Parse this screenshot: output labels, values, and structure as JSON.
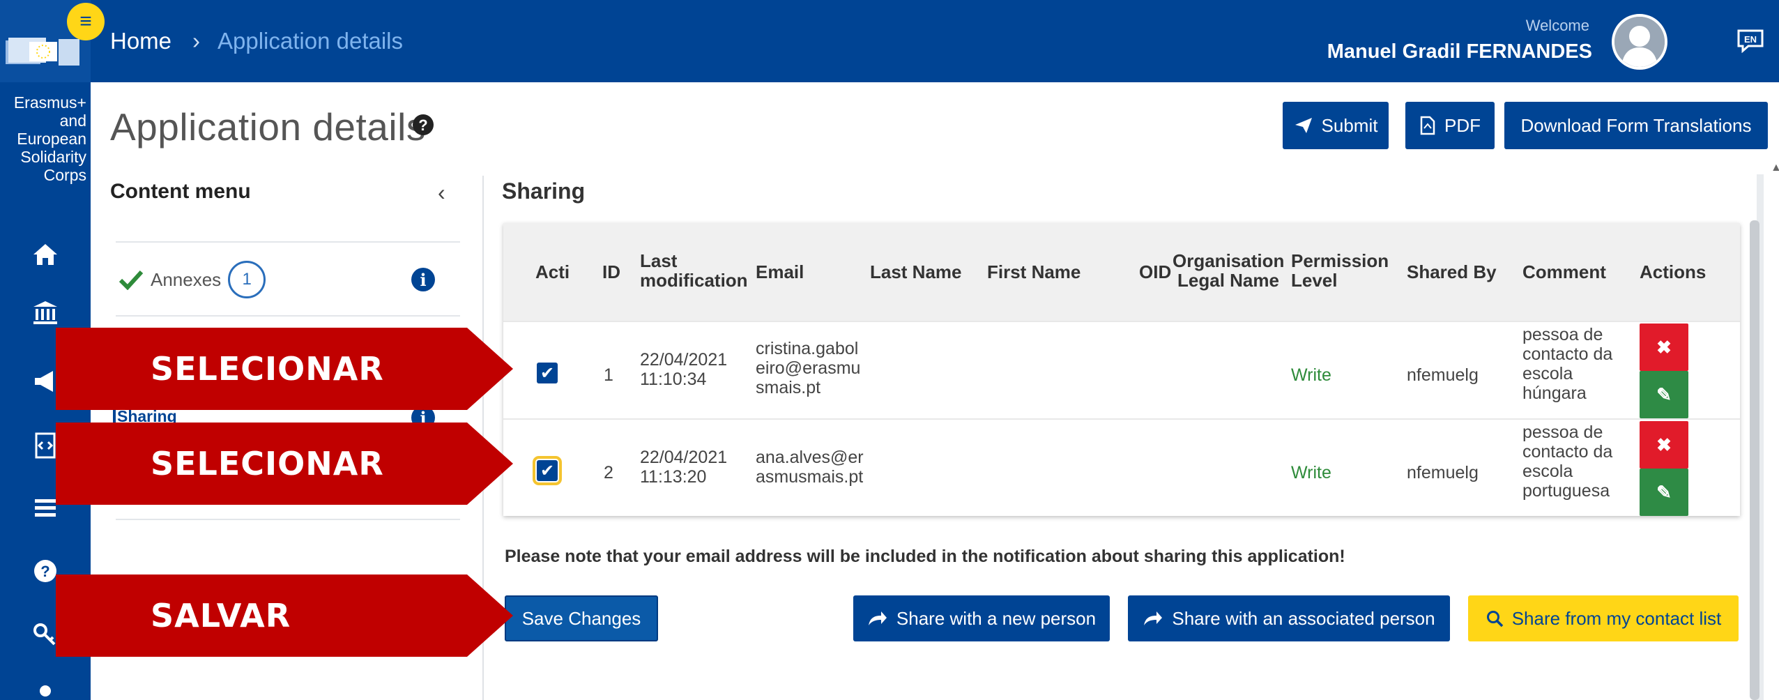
{
  "header": {
    "breadcrumb_home": "Home",
    "breadcrumb_separator": "›",
    "breadcrumb_current": "Application details",
    "welcome_label": "Welcome",
    "user_name": "Manuel Gradil FERNANDES",
    "language": "EN",
    "menu_icon": "hamburger-icon"
  },
  "sidebar": {
    "program_name": "Erasmus+ and European Solidarity Corps",
    "icons": [
      "home-icon",
      "institution-icon",
      "megaphone-icon",
      "code-document-icon",
      "list-icon",
      "help-icon",
      "key-icon"
    ]
  },
  "page": {
    "title": "Application details",
    "submit_label": "Submit",
    "pdf_label": "PDF",
    "download_label": "Download Form Translations"
  },
  "content_menu": {
    "title": "Content menu",
    "annexes_label": "Annexes",
    "annexes_count": "1",
    "sharing_label": "Sharing"
  },
  "sharing": {
    "title": "Sharing",
    "columns": {
      "active": "Acti",
      "id": "ID",
      "last_modification": "Last modification",
      "email": "Email",
      "last_name": "Last Name",
      "first_name": "First Name",
      "oid": "OID",
      "org_legal_name": "Organisation Legal Name",
      "permission_level": "Permission Level",
      "shared_by": "Shared By",
      "comment": "Comment",
      "actions": "Actions"
    },
    "rows": [
      {
        "checked": true,
        "id": "1",
        "date": "22/04/2021",
        "time": "11:10:34",
        "email_l1": "cristina.gabol",
        "email_l2": "eiro@erasmu",
        "email_l3": "smais.pt",
        "permission": "Write",
        "shared_by": "nfemuelg",
        "comment_l1": "pessoa de",
        "comment_l2": "contacto da",
        "comment_l3": "escola",
        "comment_l4": "húngara"
      },
      {
        "checked": true,
        "id": "2",
        "date": "22/04/2021",
        "time": "11:13:20",
        "email_l1": "ana.alves@er",
        "email_l2": "asmusmais.pt",
        "email_l3": "",
        "permission": "Write",
        "shared_by": "nfemuelg",
        "comment_l1": "pessoa de",
        "comment_l2": "contacto da",
        "comment_l3": "escola",
        "comment_l4": "portuguesa"
      }
    ],
    "note": "Please note that your email address will be included in the notification about sharing this application!",
    "save_label": "Save Changes",
    "share_new_label": "Share with a new person",
    "share_associated_label": "Share with an associated person",
    "share_contacts_label": "Share from my contact list"
  },
  "callouts": {
    "select_1": "SELECIONAR",
    "select_2": "SELECIONAR",
    "save": "SALVAR"
  },
  "colors": {
    "brand_blue": "#004494",
    "accent_yellow": "#ffd617",
    "callout_red": "#c00000",
    "delete_red": "#e11b2a",
    "edit_green": "#2e8b45",
    "write_green": "#2e8b3a"
  }
}
